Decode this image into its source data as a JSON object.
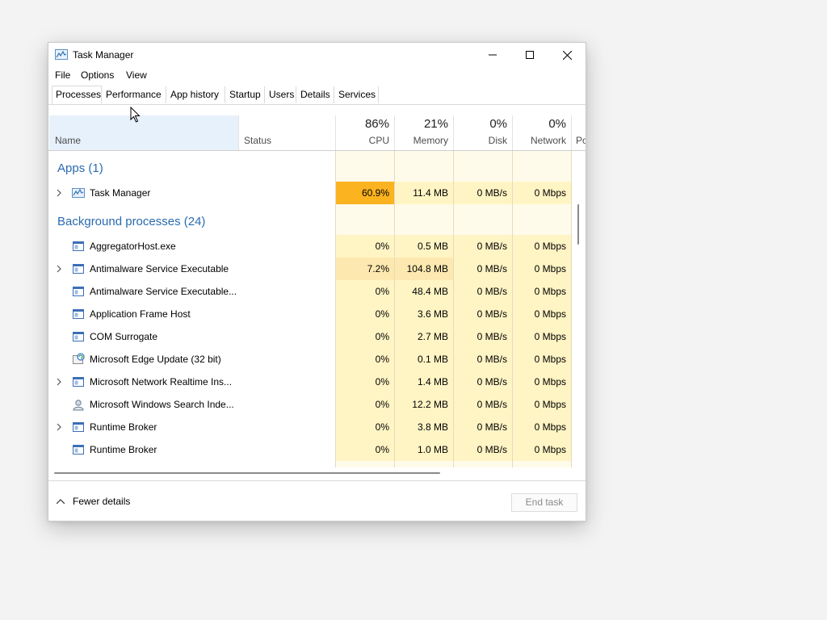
{
  "window": {
    "title": "Task Manager"
  },
  "menu": [
    "File",
    "Options",
    "View"
  ],
  "tabs": [
    "Processes",
    "Performance",
    "App history",
    "Startup",
    "Users",
    "Details",
    "Services"
  ],
  "header": {
    "name": "Name",
    "status": "Status",
    "cpu_pct": "86%",
    "cpu": "CPU",
    "memory_pct": "21%",
    "memory": "Memory",
    "disk_pct": "0%",
    "disk": "Disk",
    "network_pct": "0%",
    "network": "Network",
    "power": "Po"
  },
  "sections": {
    "apps": "Apps (1)",
    "background": "Background processes (24)"
  },
  "apps": [
    {
      "name": "Task Manager",
      "cpu": "60.9%",
      "memory": "11.4 MB",
      "disk": "0 MB/s",
      "network": "0 Mbps",
      "icon": "task-manager-icon"
    }
  ],
  "background": [
    {
      "name": "AggregatorHost.exe",
      "cpu": "0%",
      "memory": "0.5 MB",
      "disk": "0 MB/s",
      "network": "0 Mbps",
      "icon": "app-window-icon"
    },
    {
      "name": "Antimalware Service Executable",
      "cpu": "7.2%",
      "memory": "104.8 MB",
      "disk": "0 MB/s",
      "network": "0 Mbps",
      "icon": "app-window-icon"
    },
    {
      "name": "Antimalware Service Executable...",
      "cpu": "0%",
      "memory": "48.4 MB",
      "disk": "0 MB/s",
      "network": "0 Mbps",
      "icon": "app-window-icon"
    },
    {
      "name": "Application Frame Host",
      "cpu": "0%",
      "memory": "3.6 MB",
      "disk": "0 MB/s",
      "network": "0 Mbps",
      "icon": "app-window-icon"
    },
    {
      "name": "COM Surrogate",
      "cpu": "0%",
      "memory": "2.7 MB",
      "disk": "0 MB/s",
      "network": "0 Mbps",
      "icon": "app-window-icon"
    },
    {
      "name": "Microsoft Edge Update (32 bit)",
      "cpu": "0%",
      "memory": "0.1 MB",
      "disk": "0 MB/s",
      "network": "0 Mbps",
      "icon": "edge-update-icon"
    },
    {
      "name": "Microsoft Network Realtime Ins...",
      "cpu": "0%",
      "memory": "1.4 MB",
      "disk": "0 MB/s",
      "network": "0 Mbps",
      "icon": "app-window-icon"
    },
    {
      "name": "Microsoft Windows Search Inde...",
      "cpu": "0%",
      "memory": "12.2 MB",
      "disk": "0 MB/s",
      "network": "0 Mbps",
      "icon": "search-indexer-icon"
    },
    {
      "name": "Runtime Broker",
      "cpu": "0%",
      "memory": "3.8 MB",
      "disk": "0 MB/s",
      "network": "0 Mbps",
      "icon": "app-window-icon"
    },
    {
      "name": "Runtime Broker",
      "cpu": "0%",
      "memory": "1.0 MB",
      "disk": "0 MB/s",
      "network": "0 Mbps",
      "icon": "app-window-icon"
    }
  ],
  "footer": {
    "fewer_details": "Fewer details",
    "end_task": "End task"
  },
  "colors": {
    "accent": "#2a6bb0",
    "heat_high": "#fbb320",
    "heat_mid": "#fde9b0",
    "heat_low": "#fff4c4",
    "heat_faint": "#fffbea",
    "header_selected": "#e6f1fb"
  }
}
